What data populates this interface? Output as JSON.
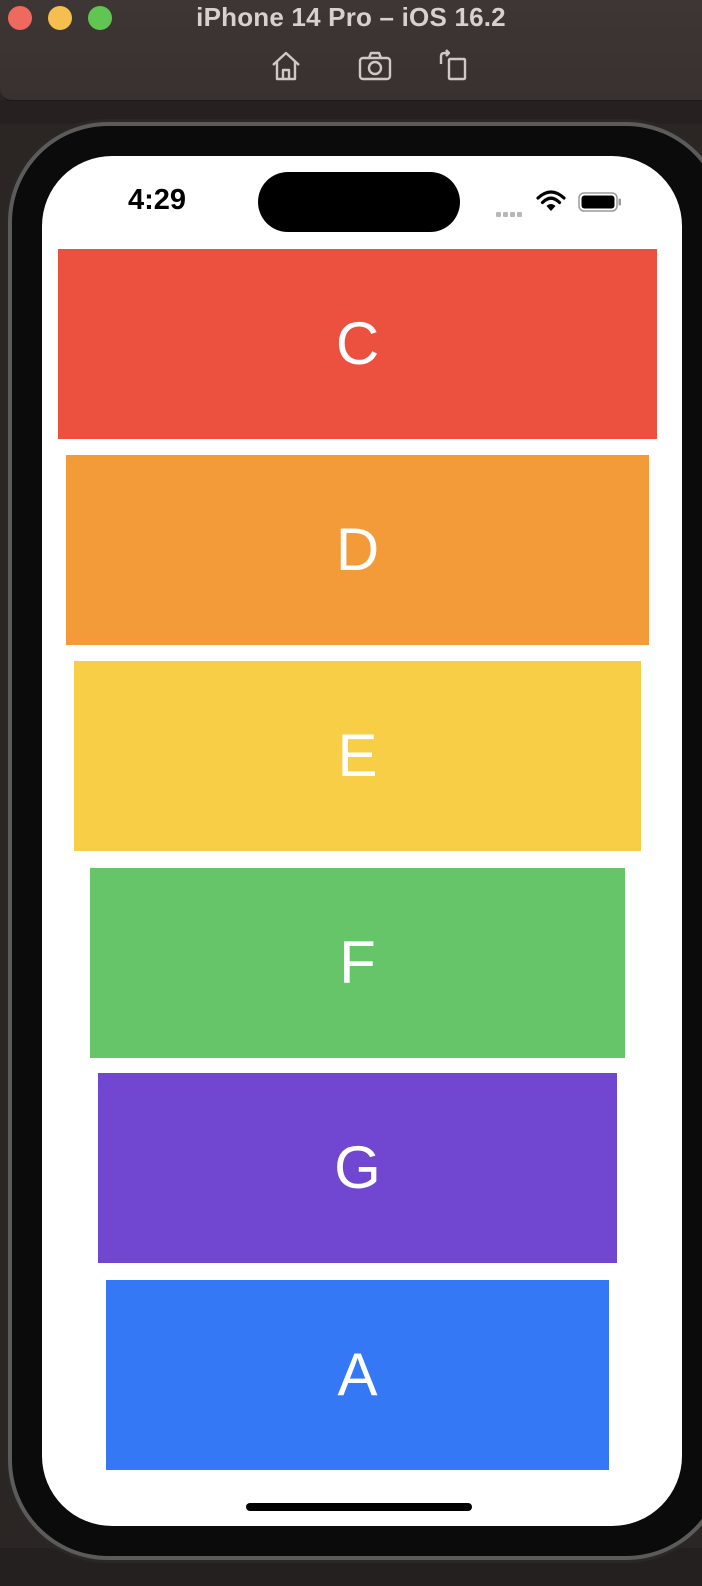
{
  "window": {
    "title": "iPhone 14 Pro – iOS 16.2",
    "toolbar_icons": [
      "home-icon",
      "screenshot-icon",
      "rotate-icon"
    ]
  },
  "status_bar": {
    "time": "4:29",
    "icons": [
      "cellular-signal-icon",
      "wifi-icon",
      "battery-icon"
    ]
  },
  "bars": [
    {
      "label": "C",
      "color": "#ec5140"
    },
    {
      "label": "D",
      "color": "#f29b38"
    },
    {
      "label": "E",
      "color": "#f7ce46"
    },
    {
      "label": "F",
      "color": "#66c569"
    },
    {
      "label": "G",
      "color": "#7147d2"
    },
    {
      "label": "A",
      "color": "#3478f6"
    }
  ]
}
